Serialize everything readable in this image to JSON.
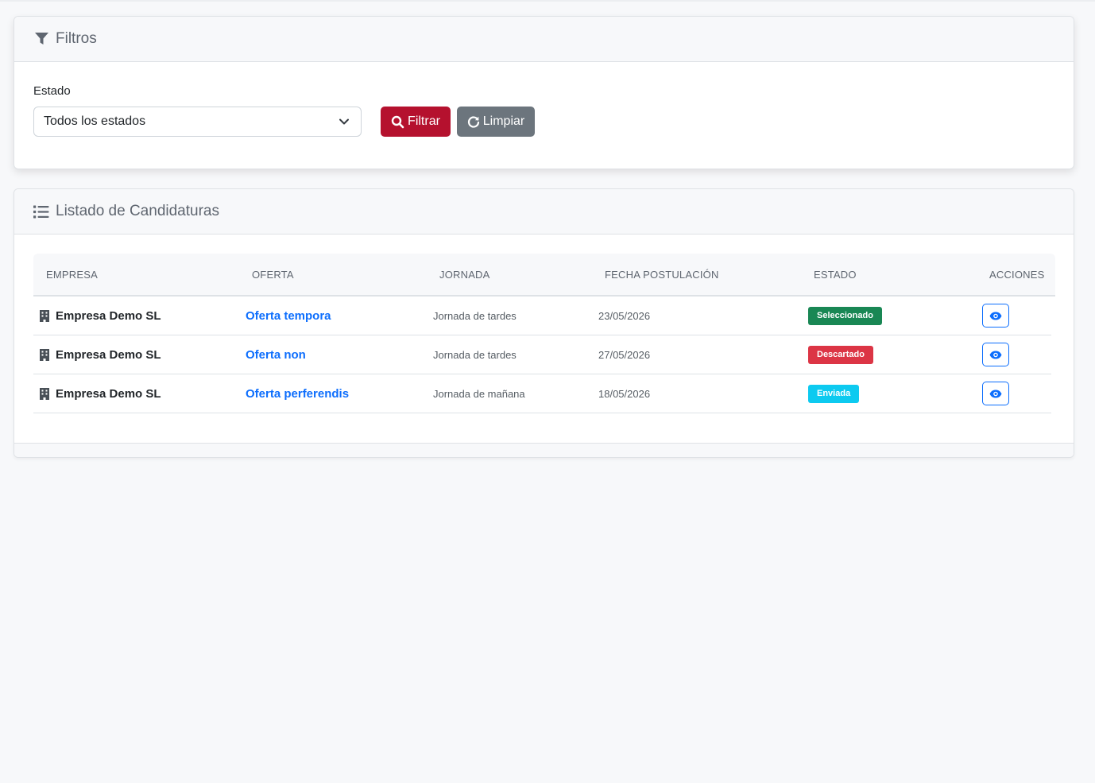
{
  "filters": {
    "title": "Filtros",
    "estado_label": "Estado",
    "estado_selected": "Todos los estados",
    "filter_button": "Filtrar",
    "clear_button": "Limpiar"
  },
  "listing": {
    "title": "Listado de Candidaturas",
    "columns": {
      "empresa": "EMPRESA",
      "oferta": "OFERTA",
      "jornada": "JORNADA",
      "fecha": "FECHA POSTULACIÓN",
      "estado": "ESTADO",
      "acciones": "ACCIONES"
    },
    "rows": [
      {
        "empresa": "Empresa Demo SL",
        "oferta": "Oferta tempora",
        "jornada": "Jornada de tardes",
        "fecha": "23/05/2026",
        "estado": "Seleccionado",
        "estado_color": "#198754"
      },
      {
        "empresa": "Empresa Demo SL",
        "oferta": "Oferta non",
        "jornada": "Jornada de tardes",
        "fecha": "27/05/2026",
        "estado": "Descartado",
        "estado_color": "#dc3545"
      },
      {
        "empresa": "Empresa Demo SL",
        "oferta": "Oferta perferendis",
        "jornada": "Jornada de mañana",
        "fecha": "18/05/2026",
        "estado": "Enviada",
        "estado_color": "#0dcaf0"
      }
    ]
  },
  "icons": {
    "filter": "filter-icon",
    "list": "list-icon",
    "search": "search-icon",
    "refresh": "refresh-icon",
    "building": "building-icon",
    "eye": "eye-icon",
    "chevron": "chevron-down-icon"
  },
  "colors": {
    "primary_button": "#b5112e",
    "secondary_button": "#6c757d",
    "link": "#0d6efd"
  }
}
